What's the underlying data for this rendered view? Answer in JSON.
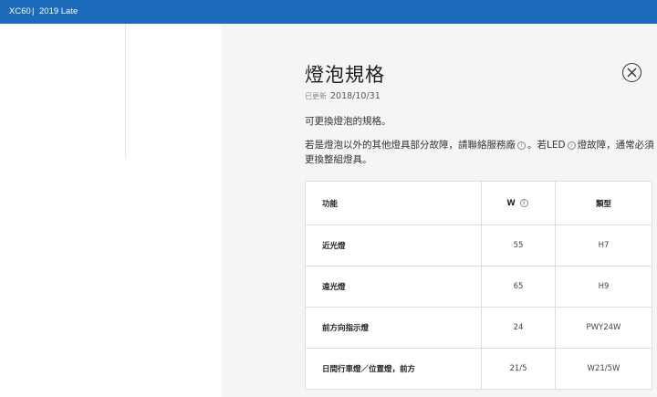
{
  "topbar": {
    "model": "XC60",
    "separator": "|",
    "year": "2019 Late"
  },
  "article": {
    "title": "燈泡規格",
    "updated_label": "已更新",
    "updated_date": "2018/10/31",
    "para1": "可更換燈泡的規格。",
    "para2_part1": "若是燈泡以外的其他燈具部分故障，請聯絡服務廠",
    "para2_part2": "。若LED",
    "para2_part3": "燈故障，通常必須更換整組燈具。",
    "info_glyph": "i"
  },
  "table": {
    "headers": [
      "功能",
      "W",
      "類型"
    ],
    "rows": [
      [
        "近光燈",
        "55",
        "H7"
      ],
      [
        "遠光燈",
        "65",
        "H9"
      ],
      [
        "前方向指示燈",
        "24",
        "PWY24W"
      ],
      [
        "日間行車燈／位置燈，前方",
        "21/5",
        "W21/5W"
      ]
    ]
  }
}
